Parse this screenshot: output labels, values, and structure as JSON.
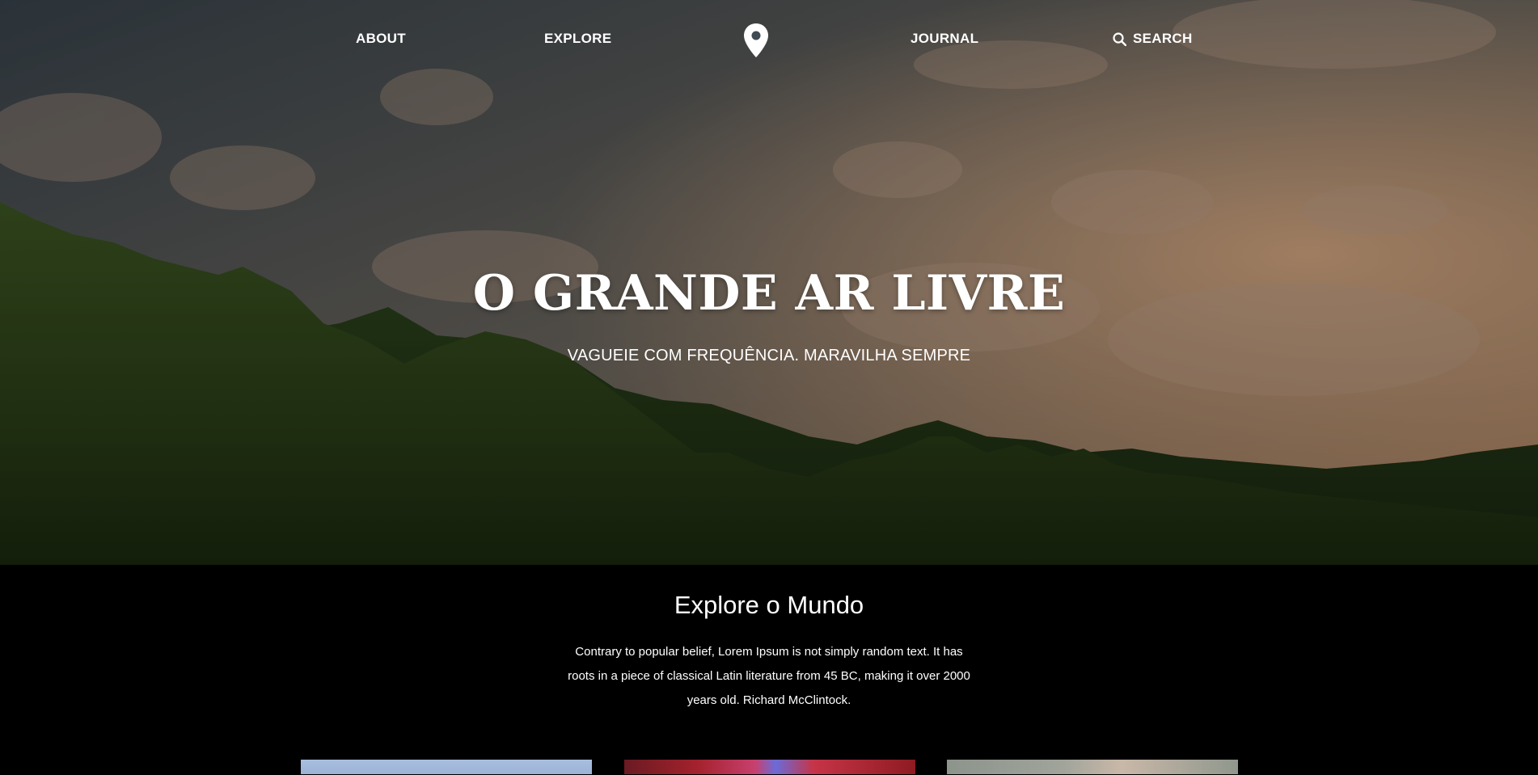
{
  "nav": {
    "about": "ABOUT",
    "explore": "EXPLORE",
    "journal": "JOURNAL",
    "search": "SEARCH",
    "logo_icon": "map-pin-icon",
    "search_icon": "search-icon"
  },
  "hero": {
    "title": "O GRANDE AR LIVRE",
    "subtitle": "VAGUEIE COM FREQUÊNCIA. MARAVILHA SEMPRE"
  },
  "explore": {
    "title": "Explore o Mundo",
    "text": "Contrary to popular belief, Lorem Ipsum is not simply random text. It has roots in a piece of classical Latin literature from 45 BC, making it over 2000 years old. Richard McClintock."
  },
  "cards": [
    {
      "name": "card-sky"
    },
    {
      "name": "card-canyon"
    },
    {
      "name": "card-mountain"
    }
  ],
  "colors": {
    "page_background": "#000000",
    "text": "#ffffff"
  }
}
